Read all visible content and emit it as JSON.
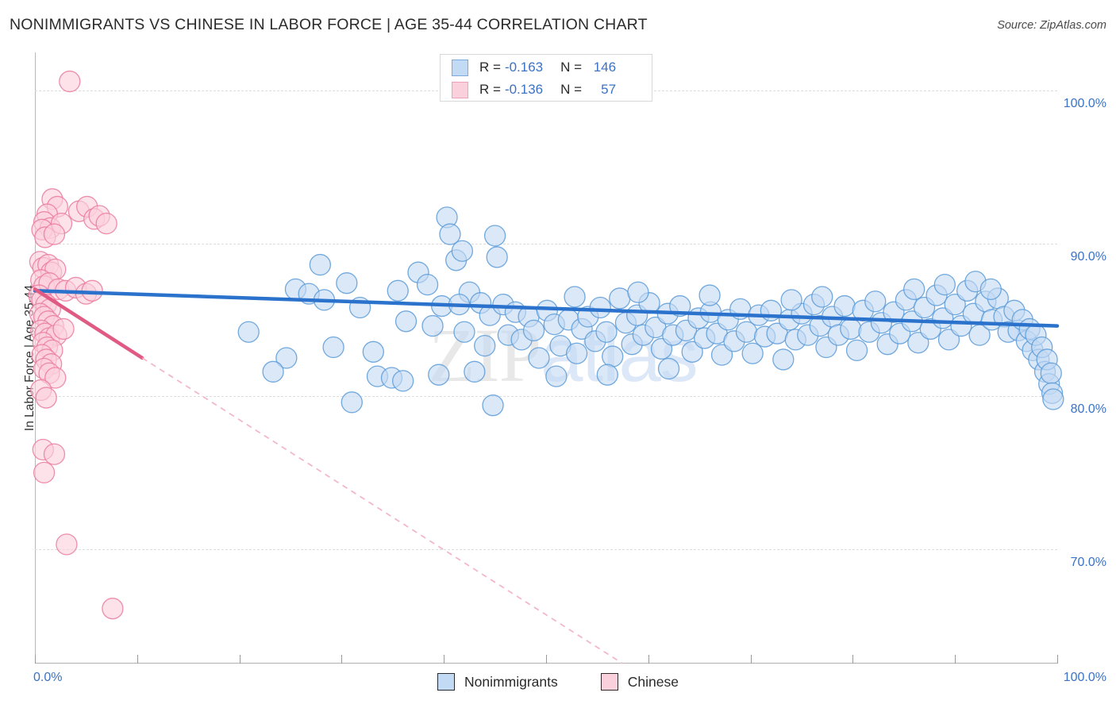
{
  "header": {
    "title": "NONIMMIGRANTS VS CHINESE IN LABOR FORCE | AGE 35-44 CORRELATION CHART",
    "source": "Source: ZipAtlas.com"
  },
  "watermark": {
    "part1": "ZIP",
    "part2": "atlas"
  },
  "legend_stats": {
    "rows": [
      {
        "r_label": "R =",
        "r_value": "-0.163",
        "n_label": "N =",
        "n_value": "146",
        "color": "#c3daf4"
      },
      {
        "r_label": "R =",
        "r_value": "-0.136",
        "n_label": "N =",
        "n_value": "57",
        "color": "#fbd0dd"
      }
    ]
  },
  "bottom_legend": {
    "items": [
      {
        "label": "Nonimmigrants",
        "color": "#c3daf4",
        "border": "#7aa9dd"
      },
      {
        "label": "Chinese",
        "color": "#fbd0dd",
        "border": "#f0a0b8"
      }
    ]
  },
  "axes": {
    "ylabel": "In Labor Force | Age 35-44",
    "ytick_labels": [
      "100.0%",
      "90.0%",
      "80.0%",
      "70.0%"
    ],
    "xtick_labels": [
      "0.0%",
      "100.0%"
    ]
  },
  "chart_data": {
    "type": "scatter",
    "title": "NONIMMIGRANTS VS CHINESE IN LABOR FORCE | AGE 35-44 CORRELATION CHART",
    "xlabel": "",
    "ylabel": "In Labor Force | Age 35-44",
    "xlim": [
      0,
      100
    ],
    "ylim": [
      62.5,
      102.5
    ],
    "xticks": [
      0,
      10,
      20,
      30,
      40,
      50,
      60,
      70,
      80,
      90,
      100
    ],
    "yticks": [
      70,
      80,
      90,
      100
    ],
    "grid": true,
    "legend_position": "bottom-center",
    "series": [
      {
        "name": "Nonimmigrants",
        "color": "#c3daf4",
        "border": "#5b9bd8",
        "R": -0.163,
        "N": 146,
        "trend": {
          "x0": 0,
          "y0": 86.9,
          "x1": 100,
          "y1": 84.6,
          "style": "solid",
          "color": "#2a72cc"
        },
        "points": [
          [
            20.9,
            84.2
          ],
          [
            24.6,
            82.5
          ],
          [
            23.3,
            81.6
          ],
          [
            25.5,
            87.0
          ],
          [
            26.8,
            86.7
          ],
          [
            27.9,
            88.6
          ],
          [
            29.2,
            83.2
          ],
          [
            28.3,
            86.3
          ],
          [
            30.5,
            87.4
          ],
          [
            31.0,
            79.6
          ],
          [
            31.8,
            85.8
          ],
          [
            33.1,
            82.9
          ],
          [
            33.5,
            81.3
          ],
          [
            35.5,
            86.9
          ],
          [
            36.3,
            84.9
          ],
          [
            34.9,
            81.2
          ],
          [
            37.5,
            88.1
          ],
          [
            38.4,
            87.3
          ],
          [
            38.9,
            84.6
          ],
          [
            39.5,
            81.4
          ],
          [
            36.0,
            81.0
          ],
          [
            40.3,
            91.7
          ],
          [
            40.6,
            90.6
          ],
          [
            41.2,
            88.9
          ],
          [
            39.8,
            85.9
          ],
          [
            41.8,
            89.5
          ],
          [
            42.5,
            86.8
          ],
          [
            42.0,
            84.2
          ],
          [
            43.6,
            86.1
          ],
          [
            43.0,
            81.6
          ],
          [
            44.5,
            85.3
          ],
          [
            44.0,
            83.3
          ],
          [
            45.2,
            89.1
          ],
          [
            45.8,
            86.0
          ],
          [
            46.3,
            84.0
          ],
          [
            44.8,
            79.4
          ],
          [
            47.0,
            85.5
          ],
          [
            47.6,
            83.7
          ],
          [
            48.3,
            85.2
          ],
          [
            48.8,
            84.3
          ],
          [
            49.3,
            82.5
          ],
          [
            50.1,
            85.6
          ],
          [
            50.8,
            84.7
          ],
          [
            51.4,
            83.3
          ],
          [
            51.0,
            81.3
          ],
          [
            52.2,
            85.0
          ],
          [
            52.8,
            86.5
          ],
          [
            53.5,
            84.4
          ],
          [
            53.0,
            82.8
          ],
          [
            54.1,
            85.2
          ],
          [
            54.8,
            83.6
          ],
          [
            55.3,
            85.8
          ],
          [
            55.9,
            84.2
          ],
          [
            56.5,
            82.6
          ],
          [
            56.0,
            81.4
          ],
          [
            57.2,
            86.4
          ],
          [
            57.8,
            84.8
          ],
          [
            58.4,
            83.4
          ],
          [
            58.9,
            85.3
          ],
          [
            59.5,
            84.0
          ],
          [
            60.1,
            86.1
          ],
          [
            60.7,
            84.5
          ],
          [
            61.3,
            83.1
          ],
          [
            61.9,
            85.4
          ],
          [
            62.4,
            84.0
          ],
          [
            62.0,
            81.8
          ],
          [
            63.1,
            85.9
          ],
          [
            63.7,
            84.3
          ],
          [
            64.3,
            82.9
          ],
          [
            64.9,
            85.1
          ],
          [
            65.5,
            83.8
          ],
          [
            66.1,
            85.5
          ],
          [
            66.7,
            84.1
          ],
          [
            67.2,
            82.7
          ],
          [
            67.8,
            85.0
          ],
          [
            68.4,
            83.6
          ],
          [
            69.0,
            85.7
          ],
          [
            69.6,
            84.2
          ],
          [
            70.2,
            82.8
          ],
          [
            70.8,
            85.3
          ],
          [
            71.4,
            83.9
          ],
          [
            72.0,
            85.6
          ],
          [
            72.6,
            84.1
          ],
          [
            73.2,
            82.4
          ],
          [
            73.8,
            85.0
          ],
          [
            74.4,
            83.7
          ],
          [
            75.0,
            85.4
          ],
          [
            75.6,
            84.0
          ],
          [
            76.2,
            86.0
          ],
          [
            76.8,
            84.6
          ],
          [
            77.4,
            83.2
          ],
          [
            78.0,
            85.2
          ],
          [
            78.6,
            84.0
          ],
          [
            79.2,
            85.9
          ],
          [
            79.8,
            84.4
          ],
          [
            80.4,
            83.0
          ],
          [
            81.0,
            85.6
          ],
          [
            81.6,
            84.2
          ],
          [
            82.2,
            86.2
          ],
          [
            82.8,
            84.8
          ],
          [
            83.4,
            83.4
          ],
          [
            84.0,
            85.5
          ],
          [
            84.6,
            84.1
          ],
          [
            85.2,
            86.3
          ],
          [
            85.8,
            84.9
          ],
          [
            86.4,
            83.5
          ],
          [
            87.0,
            85.8
          ],
          [
            87.6,
            84.4
          ],
          [
            88.2,
            86.6
          ],
          [
            88.8,
            85.1
          ],
          [
            89.4,
            83.7
          ],
          [
            90.0,
            86.0
          ],
          [
            90.6,
            84.6
          ],
          [
            91.2,
            86.9
          ],
          [
            91.8,
            85.4
          ],
          [
            92.4,
            84.0
          ],
          [
            93.0,
            86.2
          ],
          [
            93.6,
            85.0
          ],
          [
            94.2,
            86.4
          ],
          [
            94.8,
            85.2
          ],
          [
            95.2,
            84.2
          ],
          [
            95.8,
            85.6
          ],
          [
            96.2,
            84.3
          ],
          [
            96.6,
            85.0
          ],
          [
            97.0,
            83.6
          ],
          [
            97.3,
            84.4
          ],
          [
            97.6,
            83.0
          ],
          [
            97.9,
            84.0
          ],
          [
            98.2,
            82.4
          ],
          [
            98.5,
            83.2
          ],
          [
            98.8,
            81.6
          ],
          [
            99.0,
            82.4
          ],
          [
            99.2,
            80.8
          ],
          [
            99.4,
            81.5
          ],
          [
            99.5,
            80.2
          ],
          [
            99.6,
            79.8
          ],
          [
            86.0,
            87.0
          ],
          [
            89.0,
            87.3
          ],
          [
            92.0,
            87.5
          ],
          [
            93.5,
            87.0
          ],
          [
            45.0,
            90.5
          ],
          [
            41.5,
            86.0
          ],
          [
            59.0,
            86.8
          ],
          [
            66.0,
            86.6
          ],
          [
            74.0,
            86.3
          ],
          [
            77.0,
            86.5
          ]
        ]
      },
      {
        "name": "Chinese",
        "color": "#fbd0dd",
        "border": "#ea7b9f",
        "R": -0.136,
        "N": 57,
        "trend": {
          "x0": 0,
          "y0": 87.0,
          "x1": 10.5,
          "y1": 82.5,
          "style": "solid",
          "color": "#e05b84"
        },
        "trend_dashed": {
          "x0": 10.5,
          "y0": 82.5,
          "x1": 57.5,
          "y1": 62.5,
          "style": "dashed",
          "color": "#f3b8c8"
        },
        "points": [
          [
            3.4,
            100.6
          ],
          [
            1.7,
            92.9
          ],
          [
            2.2,
            92.4
          ],
          [
            1.2,
            91.9
          ],
          [
            0.9,
            91.4
          ],
          [
            1.5,
            91.0
          ],
          [
            2.6,
            91.3
          ],
          [
            4.3,
            92.1
          ],
          [
            5.1,
            92.4
          ],
          [
            5.8,
            91.6
          ],
          [
            6.3,
            91.8
          ],
          [
            7.0,
            91.3
          ],
          [
            0.7,
            90.9
          ],
          [
            1.0,
            90.4
          ],
          [
            1.9,
            90.6
          ],
          [
            0.5,
            88.8
          ],
          [
            0.8,
            88.4
          ],
          [
            1.3,
            88.6
          ],
          [
            1.6,
            88.1
          ],
          [
            2.0,
            88.3
          ],
          [
            0.6,
            87.6
          ],
          [
            0.9,
            87.2
          ],
          [
            1.4,
            87.4
          ],
          [
            2.3,
            87.0
          ],
          [
            3.0,
            86.9
          ],
          [
            4.0,
            87.1
          ],
          [
            5.0,
            86.7
          ],
          [
            5.6,
            86.9
          ],
          [
            0.4,
            86.6
          ],
          [
            0.7,
            86.3
          ],
          [
            1.1,
            86.0
          ],
          [
            1.5,
            85.7
          ],
          [
            0.5,
            85.4
          ],
          [
            0.9,
            85.2
          ],
          [
            1.3,
            84.9
          ],
          [
            1.8,
            84.6
          ],
          [
            0.6,
            84.3
          ],
          [
            1.0,
            84.1
          ],
          [
            1.4,
            83.8
          ],
          [
            2.1,
            84.0
          ],
          [
            2.8,
            84.4
          ],
          [
            0.8,
            83.5
          ],
          [
            1.2,
            83.2
          ],
          [
            1.7,
            83.0
          ],
          [
            0.7,
            82.7
          ],
          [
            1.1,
            82.4
          ],
          [
            1.6,
            82.1
          ],
          [
            0.9,
            81.8
          ],
          [
            1.4,
            81.5
          ],
          [
            2.0,
            81.2
          ],
          [
            0.6,
            80.4
          ],
          [
            1.1,
            79.9
          ],
          [
            0.8,
            76.5
          ],
          [
            1.9,
            76.2
          ],
          [
            0.9,
            75.0
          ],
          [
            3.1,
            70.3
          ],
          [
            7.6,
            66.1
          ]
        ]
      }
    ]
  }
}
